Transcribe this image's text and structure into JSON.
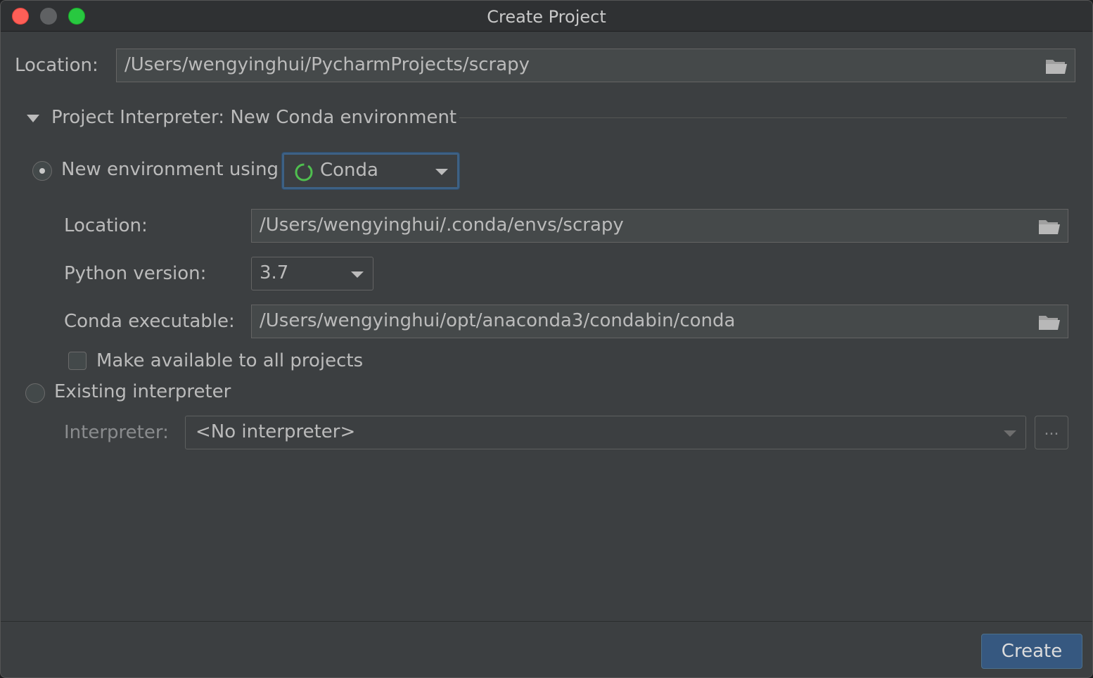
{
  "window": {
    "title": "Create Project"
  },
  "project": {
    "location_label": "Location:",
    "location_value": "/Users/wengyinghui/PycharmProjects/scrapy"
  },
  "interpreter_section": {
    "title": "Project Interpreter: New Conda environment",
    "new_env": {
      "radio_label": "New environment using",
      "selected": true,
      "tool": "Conda",
      "location_label": "Location:",
      "location_value": "/Users/wengyinghui/.conda/envs/scrapy",
      "python_version_label": "Python version:",
      "python_version_value": "3.7",
      "conda_exec_label": "Conda executable:",
      "conda_exec_value": "/Users/wengyinghui/opt/anaconda3/condabin/conda",
      "make_available_label": "Make available to all projects",
      "make_available_checked": false
    },
    "existing": {
      "radio_label": "Existing interpreter",
      "selected": false,
      "interpreter_label": "Interpreter:",
      "interpreter_value": "<No interpreter>",
      "browse_label": "..."
    }
  },
  "footer": {
    "create_label": "Create"
  },
  "colors": {
    "accent": "#365880",
    "focus_border": "#3d6185",
    "conda_icon": "#4fbf4f"
  }
}
